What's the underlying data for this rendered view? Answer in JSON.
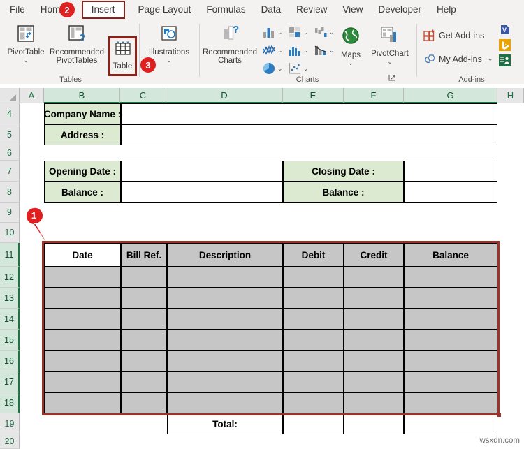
{
  "app": "Microsoft Excel",
  "ribbon": {
    "tabs": [
      {
        "label": "File",
        "active": false,
        "highlighted": false
      },
      {
        "label": "Home",
        "active": false,
        "highlighted": false
      },
      {
        "label": "Insert",
        "active": true,
        "highlighted": true
      },
      {
        "label": "Page Layout",
        "active": false,
        "highlighted": false
      },
      {
        "label": "Formulas",
        "active": false,
        "highlighted": false
      },
      {
        "label": "Data",
        "active": false,
        "highlighted": false
      },
      {
        "label": "Review",
        "active": false,
        "highlighted": false
      },
      {
        "label": "View",
        "active": false,
        "highlighted": false
      },
      {
        "label": "Developer",
        "active": false,
        "highlighted": false
      },
      {
        "label": "Help",
        "active": false,
        "highlighted": false
      }
    ],
    "groups": {
      "tables": {
        "label": "Tables",
        "pivot_table": "PivotTable",
        "recommended_pivot_tables_line1": "Recommended",
        "recommended_pivot_tables_line2": "PivotTables",
        "table": "Table"
      },
      "illustrations": {
        "label": "Illustrations"
      },
      "charts": {
        "label": "Charts",
        "recommended_charts_line1": "Recommended",
        "recommended_charts_line2": "Charts",
        "maps": "Maps",
        "pivot_chart": "PivotChart"
      },
      "addins": {
        "label": "Add-ins",
        "get_addins": "Get Add-ins",
        "my_addins": "My Add-ins"
      }
    },
    "highlight_color": "#8f2018"
  },
  "grid": {
    "columns": [
      "A",
      "B",
      "C",
      "D",
      "E",
      "F",
      "G",
      "H"
    ],
    "selected_columns": [
      "B",
      "C",
      "D",
      "E",
      "F",
      "G"
    ],
    "rows": [
      "4",
      "5",
      "6",
      "7",
      "8",
      "9",
      "10",
      "11",
      "12",
      "13",
      "14",
      "15",
      "16",
      "17",
      "18",
      "19",
      "20"
    ],
    "selected_rows": [
      "11",
      "12",
      "13",
      "14",
      "15",
      "16",
      "17",
      "18"
    ]
  },
  "sheet": {
    "header_block": [
      {
        "label": "Company Name :",
        "value": ""
      },
      {
        "label": "Address :",
        "value": ""
      }
    ],
    "date_block": [
      {
        "left_label": "Opening Date :",
        "left_value": "",
        "right_label": "Closing Date :",
        "right_value": ""
      },
      {
        "left_label": "Balance :",
        "left_value": "",
        "right_label": "Balance :",
        "right_value": ""
      }
    ],
    "table_headers": [
      "Date",
      "Bill Ref.",
      "Description",
      "Debit",
      "Credit",
      "Balance"
    ],
    "data_rows": [
      [
        "",
        "",
        "",
        "",
        "",
        ""
      ],
      [
        "",
        "",
        "",
        "",
        "",
        ""
      ],
      [
        "",
        "",
        "",
        "",
        "",
        ""
      ],
      [
        "",
        "",
        "",
        "",
        "",
        ""
      ],
      [
        "",
        "",
        "",
        "",
        "",
        ""
      ],
      [
        "",
        "",
        "",
        "",
        "",
        ""
      ],
      [
        "",
        "",
        "",
        "",
        "",
        ""
      ]
    ],
    "total_label": "Total:",
    "total_values": [
      "",
      "",
      ""
    ],
    "selection_color": "#9c322a",
    "header_fill": "#dcead1",
    "selected_fill": "#c6c6c6"
  },
  "callouts": [
    {
      "number": "1",
      "shape": "pin"
    },
    {
      "number": "2",
      "shape": "circle"
    },
    {
      "number": "3",
      "shape": "circle"
    }
  ],
  "watermark": "wsxdn.com"
}
